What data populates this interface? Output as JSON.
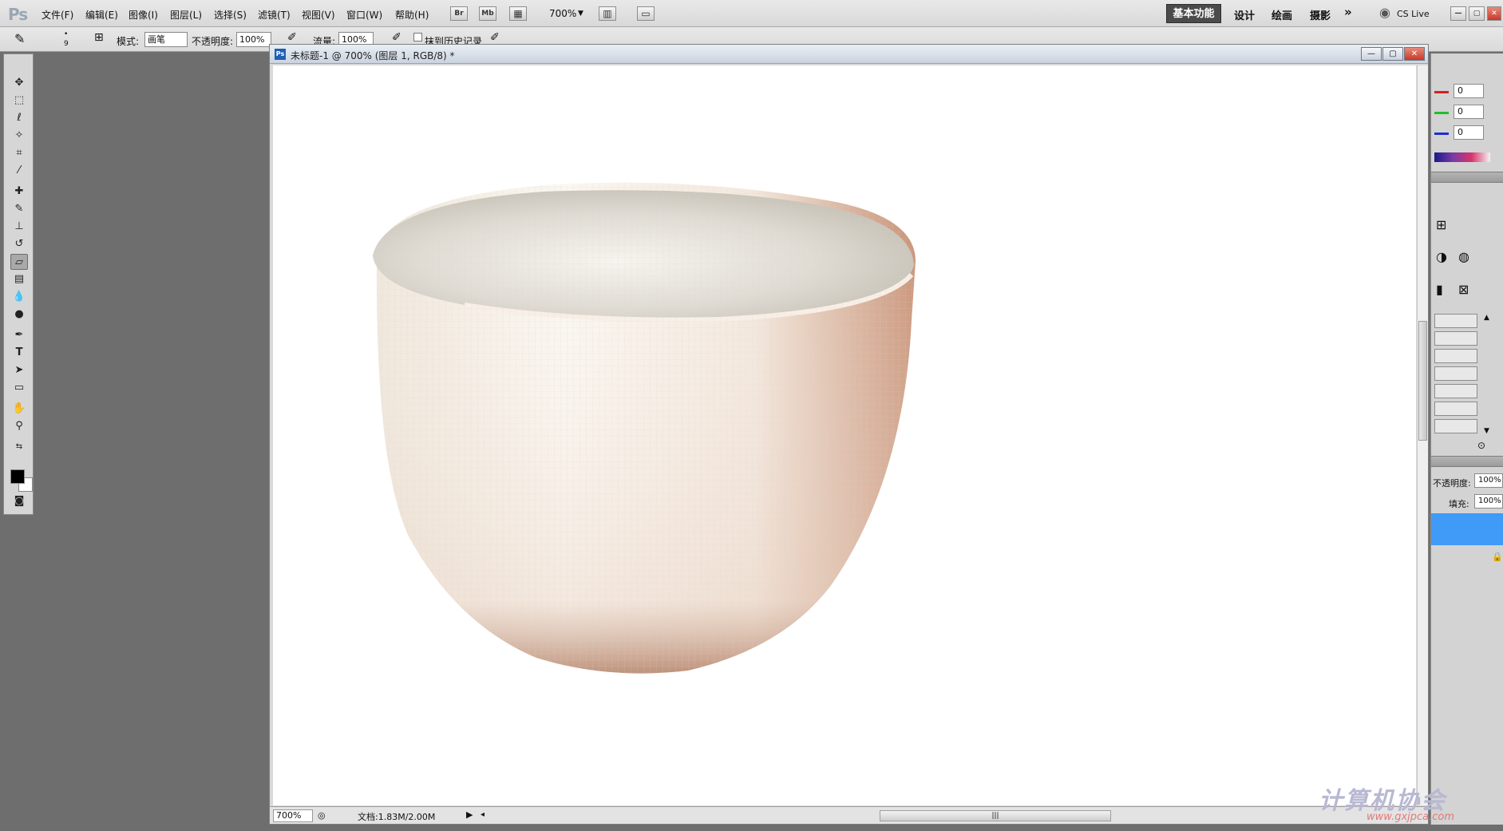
{
  "app": {
    "logo": "Ps"
  },
  "menubar": {
    "items": [
      "文件(F)",
      "编辑(E)",
      "图像(I)",
      "图层(L)",
      "选择(S)",
      "滤镜(T)",
      "视图(V)",
      "窗口(W)",
      "帮助(H)"
    ],
    "bridge_label": "Br",
    "minibridge_label": "Mb",
    "zoom_value": "700%",
    "workspaces": {
      "active": "基本功能",
      "design": "设计",
      "paint": "绘画",
      "photo": "摄影",
      "more": "»"
    },
    "cs_live": "CS Live"
  },
  "options": {
    "brush_size": "9",
    "mode_label": "模式:",
    "mode_value": "画笔",
    "opacity_label": "不透明度:",
    "opacity_value": "100%",
    "flow_label": "流量:",
    "flow_value": "100%",
    "erase_history_label": "抹到历史记录"
  },
  "document": {
    "title": "未标题-1 @ 700% (图层 1, RGB/8) *",
    "status_zoom": "700%",
    "status_doc": "文档:1.83M/2.00M"
  },
  "panels": {
    "color": {
      "r": "0",
      "g": "0",
      "b": "0"
    },
    "layers": {
      "opacity_label": "不透明度:",
      "opacity_value": "100%",
      "fill_label": "填充:",
      "fill_value": "100%"
    }
  },
  "watermark": {
    "text": "计算机协会",
    "url": "www.gxjpca.com"
  },
  "colors": {
    "accent": "#3f9af8",
    "workspace_active": "#4b4b4b",
    "red_bar": "#d51f1f",
    "green_bar": "#1fbf2a",
    "blue_bar": "#1f2fcf"
  }
}
